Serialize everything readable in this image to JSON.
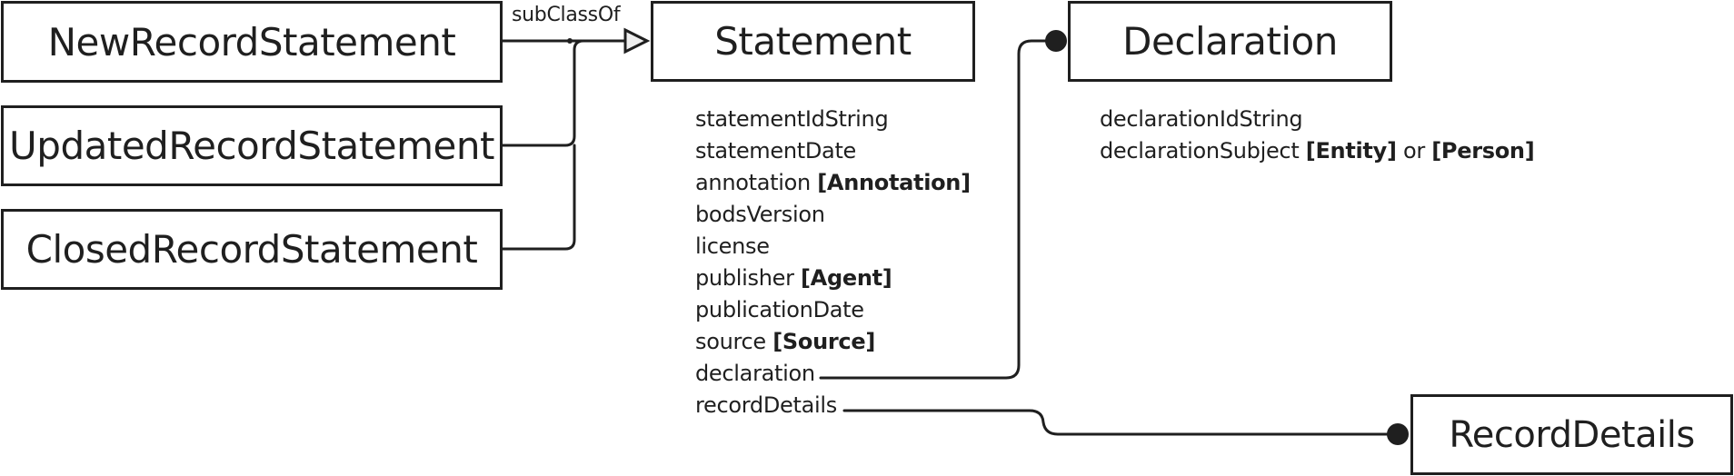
{
  "diagram": {
    "classes": {
      "new_record_statement": "NewRecordStatement",
      "updated_record_statement": "UpdatedRecordStatement",
      "closed_record_statement": "ClosedRecordStatement",
      "statement": "Statement",
      "declaration": "Declaration",
      "record_details": "RecordDetails"
    },
    "relation_label": "subClassOf",
    "statement_properties": [
      {
        "name": "statementIdString",
        "type": ""
      },
      {
        "name": "statementDate",
        "type": ""
      },
      {
        "name": "annotation",
        "type": "[Annotation]"
      },
      {
        "name": "bodsVersion",
        "type": ""
      },
      {
        "name": "license",
        "type": ""
      },
      {
        "name": "publisher",
        "type": "[Agent]"
      },
      {
        "name": "publicationDate",
        "type": ""
      },
      {
        "name": "source",
        "type": "[Source]"
      },
      {
        "name": "declaration",
        "type": ""
      },
      {
        "name": "recordDetails",
        "type": ""
      }
    ],
    "declaration_properties": [
      {
        "name": "declarationIdString",
        "type": "",
        "connector": "",
        "type2": ""
      },
      {
        "name": "declarationSubject",
        "type": "[Entity]",
        "connector": "or",
        "type2": "[Person]"
      }
    ],
    "colors": {
      "stroke": "#1f1f1f",
      "arrow_fill": "#eeeeee",
      "background": "#ffffff"
    }
  }
}
